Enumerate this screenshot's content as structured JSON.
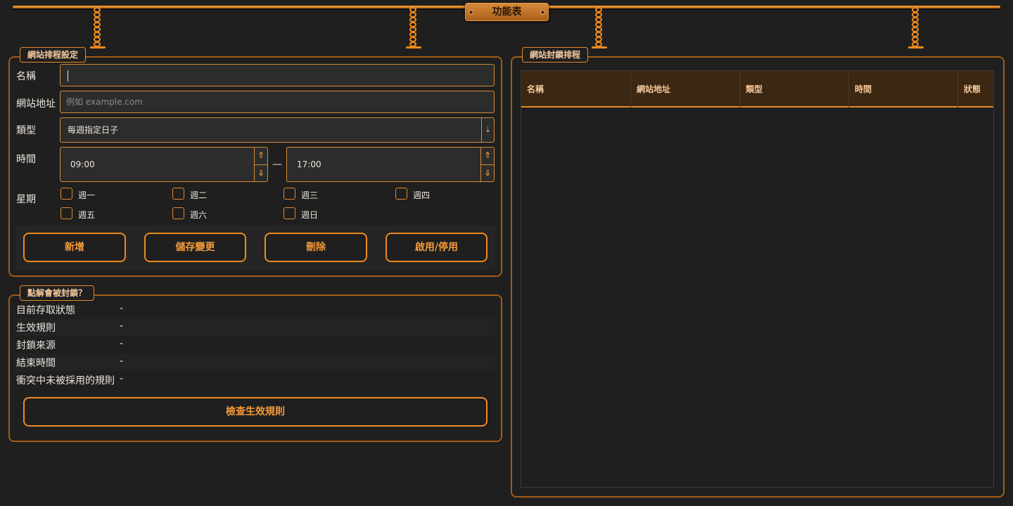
{
  "window": {
    "title": "功能表"
  },
  "schedule_panel": {
    "legend": "網站排程設定",
    "name_label": "名稱",
    "name_value": "",
    "url_label": "網站地址",
    "url_placeholder": "例如 example.com",
    "type_label": "類型",
    "type_value": "每週指定日子",
    "time_label": "時間",
    "time_start": "09:00",
    "time_end": "17:00",
    "time_separator": "—",
    "week_label": "星期",
    "days": [
      {
        "label": "週一",
        "checked": false
      },
      {
        "label": "週二",
        "checked": false
      },
      {
        "label": "週三",
        "checked": false
      },
      {
        "label": "週四",
        "checked": false
      },
      {
        "label": "週五",
        "checked": false
      },
      {
        "label": "週六",
        "checked": false
      },
      {
        "label": "週日",
        "checked": false
      }
    ],
    "buttons": {
      "add": "新增",
      "save": "儲存變更",
      "delete": "刪除",
      "toggle": "啟用/停用"
    }
  },
  "why_panel": {
    "legend": "點解會被封鎖？",
    "rows": [
      {
        "key": "目前存取狀態",
        "value": "-"
      },
      {
        "key": "生效規則",
        "value": "-"
      },
      {
        "key": "封鎖來源",
        "value": "-"
      },
      {
        "key": "結束時間",
        "value": "-"
      },
      {
        "key": "衝突中未被採用的規則",
        "value": "-"
      }
    ],
    "check_button": "檢查生效規則"
  },
  "block_panel": {
    "legend": "網站封鎖排程",
    "columns": [
      "名稱",
      "網站地址",
      "類型",
      "時間",
      "狀態"
    ],
    "rows": []
  },
  "icons": {
    "dropdown": "chevron-down-icon",
    "spin_up": "arrow-up-icon",
    "spin_down": "arrow-down-icon"
  },
  "colors": {
    "accent": "#f08a1c",
    "background": "#1f1f1f",
    "header": "#3b2712"
  }
}
